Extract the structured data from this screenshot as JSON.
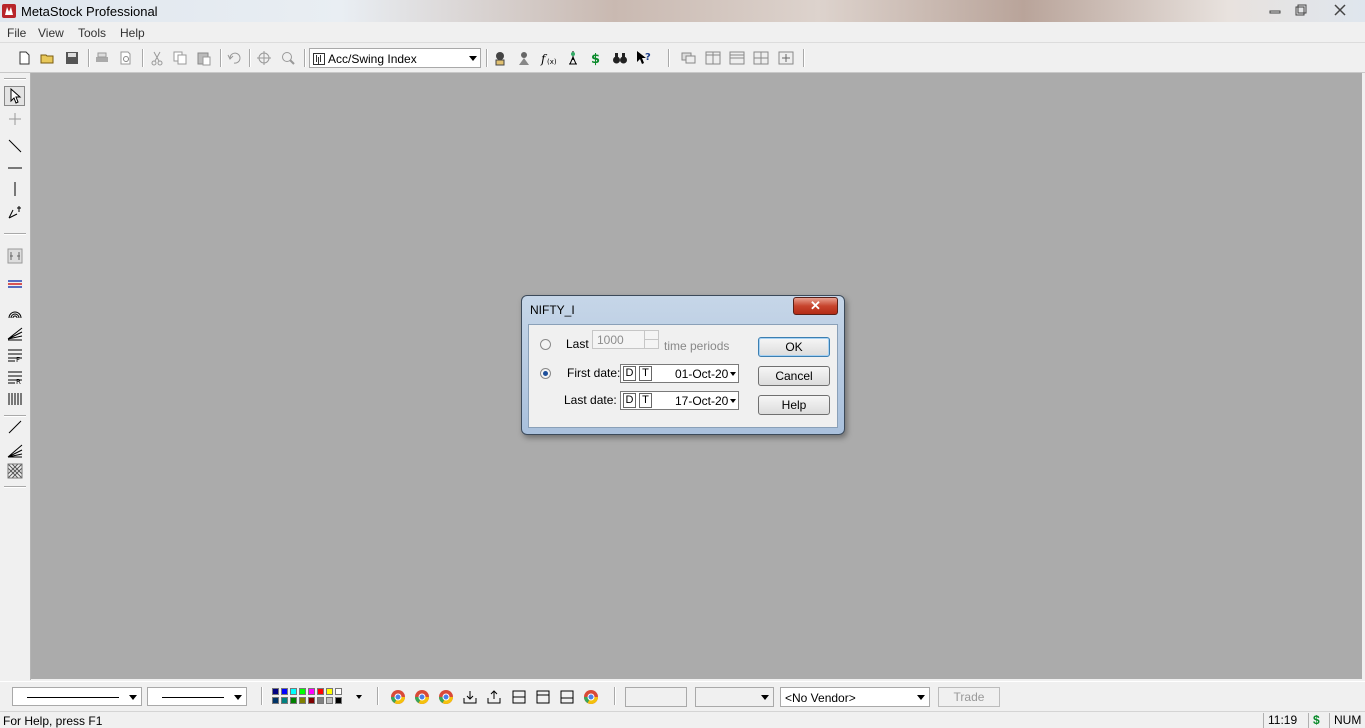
{
  "window": {
    "title": "MetaStock Professional"
  },
  "menu": [
    "File",
    "View",
    "Tools",
    "Help"
  ],
  "toolbar": {
    "indicator": "Acc/Swing Index"
  },
  "dialog": {
    "title": "NIFTY_I",
    "close_label": "✕",
    "last_label": "Last",
    "last_value": "1000",
    "time_periods": "time periods",
    "first_date_label": "First date:",
    "last_date_label": "Last date:",
    "d_label": "D",
    "t_label": "T",
    "first_date_value": "01-Oct-20",
    "last_date_value": "17-Oct-20",
    "ok": "OK",
    "cancel": "Cancel",
    "help": "Help",
    "selected_option": "first_date"
  },
  "bottombar": {
    "vendor": "<No Vendor>",
    "trade": "Trade",
    "palette": [
      "#000080",
      "#0000ff",
      "#00ffff",
      "#00ff00",
      "#ff00ff",
      "#ff0000",
      "#ffff00",
      "#ffffff",
      "#003366",
      "#008080",
      "#008000",
      "#808000",
      "#800000",
      "#808080",
      "#c0c0c0",
      "#000000"
    ]
  },
  "status": {
    "help_text": "For Help, press F1",
    "time": "11:19",
    "dollar": "$",
    "num": "NUM"
  },
  "colors": {
    "workspace": "#ababab",
    "dialog_frame": "#b4c8e0",
    "close_red": "#c7442d"
  }
}
